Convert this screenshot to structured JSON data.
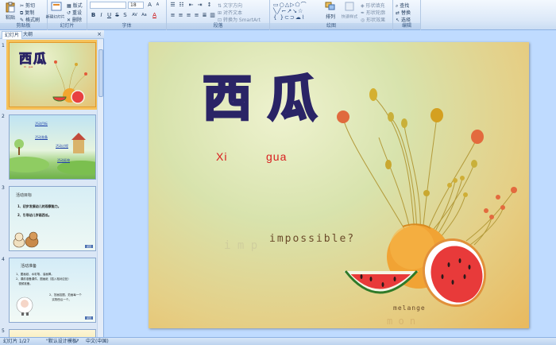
{
  "ribbon": {
    "groups": {
      "clipboard": "剪贴板",
      "slides": "幻灯片",
      "font": "字体",
      "paragraph": "段落",
      "drawing": "绘图",
      "editing": "编辑"
    },
    "paste": "粘贴",
    "cut": "剪切",
    "copy": "复制",
    "format_painter": "格式刷",
    "new_slide": "新建幻灯片",
    "layout": "版式",
    "reset": "重设",
    "delete": "删除",
    "font_size": "18",
    "text_direction": "文字方向",
    "align_text": "对齐文本",
    "convert_smartart": "转换为 SmartArt",
    "arrange": "排列",
    "quick_styles": "快速样式",
    "shape_fill": "形状填充",
    "shape_outline": "形状轮廓",
    "shape_effects": "形状效果",
    "find": "查找",
    "replace": "替换",
    "select": "选择"
  },
  "pane": {
    "tab_slides": "幻灯片",
    "tab_outline": "大纲",
    "close": "×",
    "thumbs": [
      {
        "num": "1",
        "title": "西瓜",
        "pinyin": "Xi   gua"
      },
      {
        "num": "2",
        "items": [
          "活动目标",
          "活动准备",
          "活动过程",
          "活动延伸"
        ]
      },
      {
        "num": "3",
        "heading": "活动目标",
        "lines": [
          "1、初步发展幼儿的观察能力。",
          "2、引导幼儿学画西瓜。"
        ],
        "button": "返回"
      },
      {
        "num": "4",
        "heading": "活动准备",
        "lines": [
          "1、图画纸、水彩笔、油画棒。",
          "2、课前准备课件，图画纸（插入相对应处）",
          "   视频准备。",
          "2、范画挂图，范画每一个",
          "   实物西瓜一个。"
        ],
        "button": "返回"
      },
      {
        "num": "5"
      }
    ]
  },
  "slide": {
    "title_chars": [
      "西",
      "瓜"
    ],
    "pinyin": [
      "Xi",
      "gua"
    ],
    "impossible": "impossible?",
    "melange": "melange"
  },
  "status": {
    "slide_info": "幻灯片 1/27",
    "theme": "\"默认设计模板\"",
    "language": "中文(中国)"
  },
  "colors": {
    "title_fill": "#b07ddb",
    "title_outline": "#2a2466",
    "pinyin": "#d81e1e",
    "selection": "#f6c25a"
  }
}
